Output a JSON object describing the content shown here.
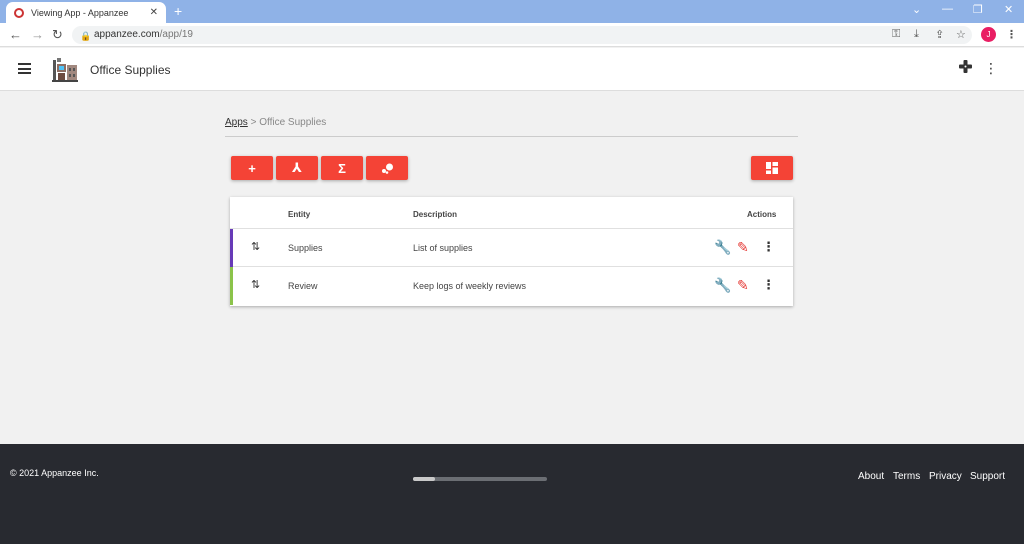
{
  "browser": {
    "tab_title": "Viewing App - Appanzee",
    "url_domain": "appanzee.com",
    "url_path": "/app/19",
    "avatar_letter": "J",
    "avatar_color": "#e91e63"
  },
  "header": {
    "title": "Office Supplies",
    "menu_icon": "hamburger-icon",
    "extra_icon": "gamepad-icon"
  },
  "breadcrumb": {
    "root": "Apps",
    "separator": ">",
    "current": "Office Supplies"
  },
  "toolbar": {
    "add_icon": "+",
    "merge_icon": "⅄",
    "sum_icon": "Σ",
    "bubble_icon": "●",
    "layout_icon": "dashboard-icon",
    "accent": "#f44336"
  },
  "table": {
    "columns": [
      "Entity",
      "Description",
      "Actions"
    ],
    "rows": [
      {
        "entity": "Supplies",
        "description": "List of supplies",
        "stripe_color": "#673ab7"
      },
      {
        "entity": "Review",
        "description": "Keep logs of weekly reviews",
        "stripe_color": "#8bc34a"
      }
    ]
  },
  "footer": {
    "copyright": "© 2021 Appanzee Inc.",
    "links": [
      "About",
      "Terms",
      "Privacy",
      "Support"
    ]
  }
}
